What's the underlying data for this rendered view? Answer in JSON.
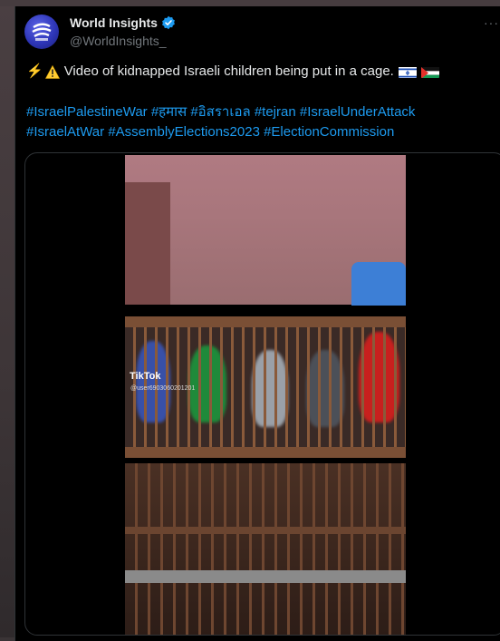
{
  "author": {
    "name": "World Insights",
    "handle": "@WorldInsights_",
    "avatar_icon": "globe-logo-icon",
    "verified": true
  },
  "more_label": "···",
  "tweet": {
    "text": "Video of kidnapped Israeli children being put in a cage.",
    "leading_icons": [
      "lightning-icon",
      "warning-icon"
    ],
    "trailing_flags": [
      "israel-flag-icon",
      "palestine-flag-icon"
    ],
    "hashtags": [
      "#IsraelPalestineWar",
      "#हमास",
      "#อิสราเอล",
      "#tejran",
      "#IsraelUnderAttack",
      "#IsraelAtWar",
      "#AssemblyElections2023",
      "#ElectionCommission"
    ]
  },
  "media": {
    "type": "video",
    "watermark": "TikTok",
    "watermark_id": "@user6903060201201"
  },
  "colors": {
    "background": "#000000",
    "text": "#e7e9ea",
    "secondary": "#71767b",
    "link": "#1d9bf0",
    "verified": "#1d9bf0"
  }
}
